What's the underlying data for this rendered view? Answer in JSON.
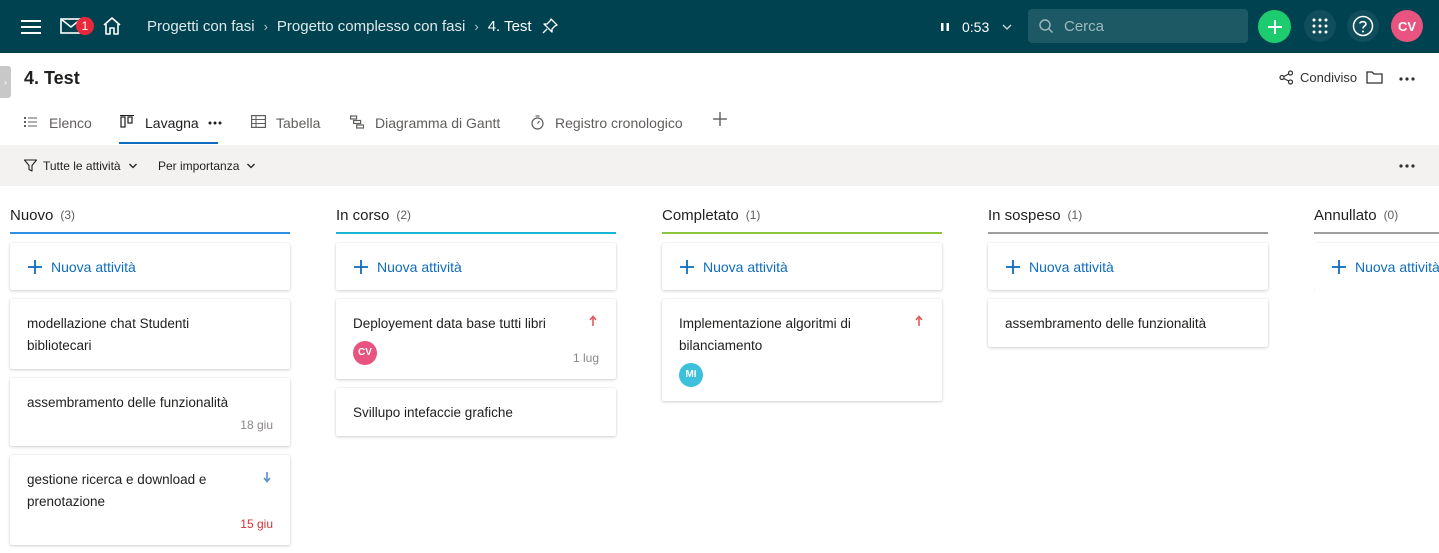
{
  "topbar": {
    "mail_badge": "1",
    "breadcrumbs": [
      "Progetti con fasi",
      "Progetto complesso con fasi",
      "4. Test"
    ],
    "timer": "0:53",
    "search_placeholder": "Cerca",
    "avatar_initials": "CV",
    "avatar_color": "#e8537f"
  },
  "project": {
    "title": "4. Test",
    "share_label": "Condiviso"
  },
  "tabs": [
    {
      "label": "Elenco",
      "icon": "list-icon"
    },
    {
      "label": "Lavagna",
      "icon": "board-icon",
      "active": true
    },
    {
      "label": "Tabella",
      "icon": "table-icon"
    },
    {
      "label": "Diagramma di Gantt",
      "icon": "gantt-icon"
    },
    {
      "label": "Registro cronologico",
      "icon": "timer-icon"
    }
  ],
  "filters": {
    "tasks_filter": "Tutte le attività",
    "sort": "Per importanza"
  },
  "board": {
    "new_task_label": "Nuova attività",
    "columns": [
      {
        "name": "Nuovo",
        "count": "(3)",
        "color": "#2f8fe6",
        "cards": [
          {
            "title": "modellazione chat Studenti bibliotecari"
          },
          {
            "title": "assembramento delle funzionalità",
            "date": "18 giu"
          },
          {
            "title": "gestione ricerca e download e prenotazione",
            "date": "15 giu",
            "overdue": true,
            "priority": "low"
          }
        ]
      },
      {
        "name": "In corso",
        "count": "(2)",
        "color": "#1ab5d4",
        "cards": [
          {
            "title": "Deployement data base tutti libri",
            "date": "1 lug",
            "priority": "high",
            "assignee": "CV",
            "assignee_color": "#e8537f"
          },
          {
            "title": "Svillupo intefaccie grafiche"
          }
        ]
      },
      {
        "name": "Completato",
        "count": "(1)",
        "color": "#8cc63f",
        "cards": [
          {
            "title": "Implementazione algoritmi di bilanciamento",
            "priority": "high",
            "assignee": "MI",
            "assignee_color": "#3cc0dc"
          }
        ]
      },
      {
        "name": "In sospeso",
        "count": "(1)",
        "color": "#a19f9d",
        "cards": [
          {
            "title": "assembramento delle funzionalità"
          }
        ]
      },
      {
        "name": "Annullato",
        "count": "(0)",
        "color": "#a19f9d",
        "cards": []
      }
    ]
  }
}
